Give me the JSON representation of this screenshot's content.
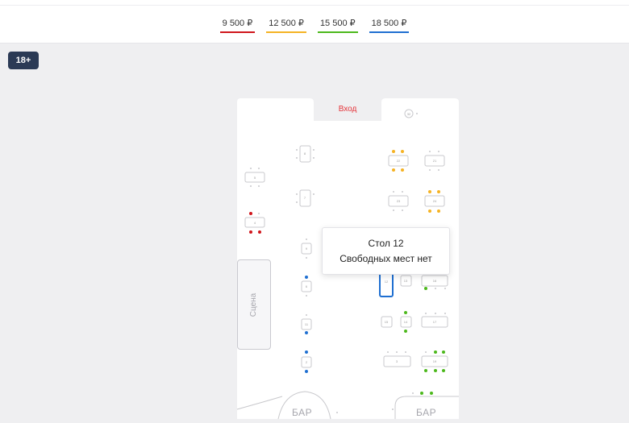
{
  "prices": [
    {
      "label": "9 500 ₽",
      "color": "#d0161c"
    },
    {
      "label": "12 500 ₽",
      "color": "#f5b324"
    },
    {
      "label": "15 500 ₽",
      "color": "#4cb81c"
    },
    {
      "label": "18 500 ₽",
      "color": "#1f6fd1"
    }
  ],
  "age_rating": "18+",
  "hall": {
    "entrance_label": "Вход",
    "stage_label": "Сцена",
    "bar_left_label": "БАР",
    "bar_right_label": "БАР",
    "tables": [
      "1",
      "2",
      "3",
      "4",
      "5",
      "6",
      "7",
      "8",
      "9",
      "10",
      "11",
      "12",
      "13",
      "14",
      "15",
      "16",
      "17",
      "19",
      "21",
      "22",
      "23",
      "24",
      "32"
    ]
  },
  "tooltip": {
    "title": "Стол 12",
    "subtitle": "Свободных мест нет"
  }
}
